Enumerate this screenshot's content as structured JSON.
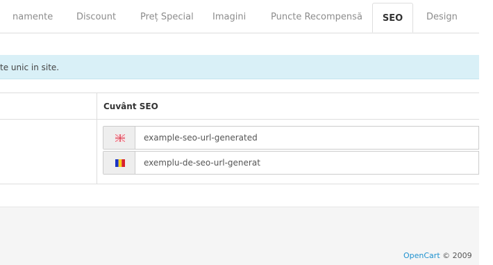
{
  "tabs": [
    {
      "label": "namente",
      "active": false
    },
    {
      "label": "Discount",
      "active": false
    },
    {
      "label": "Preț Special",
      "active": false
    },
    {
      "label": "Imagini",
      "active": false
    },
    {
      "label": "Puncte Recompensă",
      "active": false
    },
    {
      "label": "SEO",
      "active": true
    },
    {
      "label": "Design",
      "active": false
    }
  ],
  "alert": {
    "text": "te unic in site."
  },
  "seo_table": {
    "header": "Cuvânt SEO",
    "rows": [
      {
        "flag_icon": "uk-flag-icon",
        "value": "example-seo-url-generated"
      },
      {
        "flag_icon": "romania-flag-icon",
        "value": "exemplu-de-seo-url-generat"
      }
    ]
  },
  "footer": {
    "link": "OpenCart",
    "text": "© 2009"
  },
  "colors": {
    "accent_link": "#1e91cf",
    "alert_bg": "#d9f0f7",
    "footer_bg": "#f5f5f5"
  }
}
